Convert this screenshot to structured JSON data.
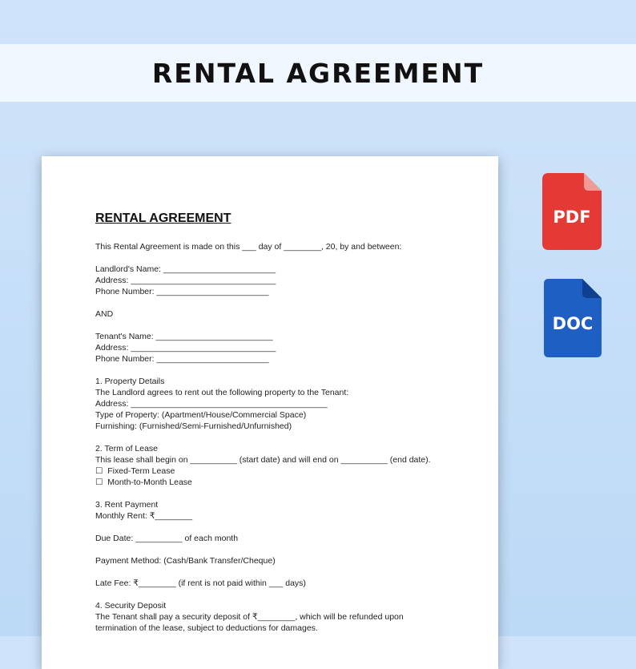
{
  "banner": {
    "title": "RENTAL AGREEMENT"
  },
  "document": {
    "title": "RENTAL AGREEMENT",
    "lines": [
      "This Rental Agreement is made on this ___ day of ________, 20, by and between:",
      "",
      "Landlord's Name: ________________________",
      "Address: _______________________________",
      "Phone Number: ________________________",
      "",
      "AND",
      "",
      "Tenant's Name: _________________________",
      "Address: _______________________________",
      "Phone Number: ________________________",
      "",
      "1. Property Details",
      "The Landlord agrees to rent out the following property to the Tenant:",
      "Address: __________________________________________",
      "Type of Property: (Apartment/House/Commercial Space)",
      "Furnishing: (Furnished/Semi-Furnished/Unfurnished)",
      "",
      "2. Term of Lease",
      "This lease shall begin on __________ (start date) and will end on __________ (end date).",
      "☐  Fixed-Term Lease",
      "☐  Month-to-Month Lease",
      "",
      "3. Rent Payment",
      "Monthly Rent: ₹________",
      "",
      "Due Date: __________ of each month",
      "",
      "Payment Method: (Cash/Bank Transfer/Cheque)",
      "",
      "Late Fee: ₹________ (if rent is not paid within ___ days)",
      "",
      "4. Security Deposit",
      "The Tenant shall pay a security deposit of ₹________, which will be refunded upon",
      "termination of the lease, subject to deductions for damages."
    ]
  },
  "badges": {
    "pdf": {
      "label": "PDF",
      "icon": "pdf-file-icon",
      "color": "#e53935",
      "fold": "#f19a98"
    },
    "doc": {
      "label": "DOC",
      "icon": "doc-file-icon",
      "color": "#1e5fc4",
      "fold": "#0f3f8f"
    }
  }
}
